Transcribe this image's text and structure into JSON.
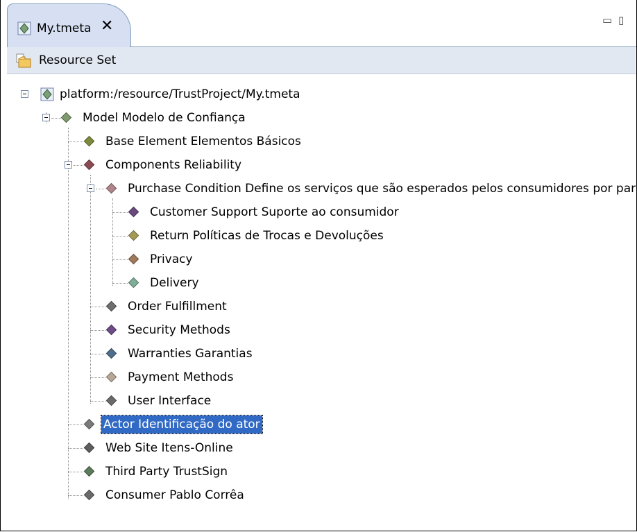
{
  "tab": {
    "title": "My.tmeta",
    "close": "✕",
    "minimize": "▭",
    "maximize": "▯"
  },
  "toolbar": {
    "label": "Resource Set"
  },
  "tree": {
    "root": "platform:/resource/TrustProject/My.tmeta",
    "nodes": [
      {
        "label": "Model Modelo de Confiança",
        "color": "#7f9a6e"
      },
      {
        "label": "Base Element Elementos Básicos",
        "color": "#7d8a3c"
      },
      {
        "label": "Components Reliability",
        "color": "#8c4b54"
      },
      {
        "label": "Purchase Condition Define os serviços que são esperados pelos consumidores por parte do",
        "color": "#b0858a"
      },
      {
        "label": "Customer Support Suporte ao consumidor",
        "color": "#6a4a7e"
      },
      {
        "label": "Return Políticas de Trocas e Devoluções",
        "color": "#a59a55"
      },
      {
        "label": "Privacy",
        "color": "#a17a5c"
      },
      {
        "label": "Delivery",
        "color": "#7fae96"
      },
      {
        "label": "Order Fulfillment",
        "color": "#6e6e6e"
      },
      {
        "label": "Security Methods",
        "color": "#6d4c88"
      },
      {
        "label": "Warranties Garantias",
        "color": "#4f6e8c"
      },
      {
        "label": "Payment Methods",
        "color": "#b8a796"
      },
      {
        "label": "User Interface",
        "color": "#6a6a6a"
      },
      {
        "label": "Actor Identificação do ator",
        "color": "#7a7a7a",
        "selected": true
      },
      {
        "label": "Web Site Itens-Online",
        "color": "#5e5e5e"
      },
      {
        "label": "Third Party TrustSign",
        "color": "#5c7a5c"
      },
      {
        "label": "Consumer Pablo Corrêa",
        "color": "#6a6a6a"
      }
    ]
  }
}
